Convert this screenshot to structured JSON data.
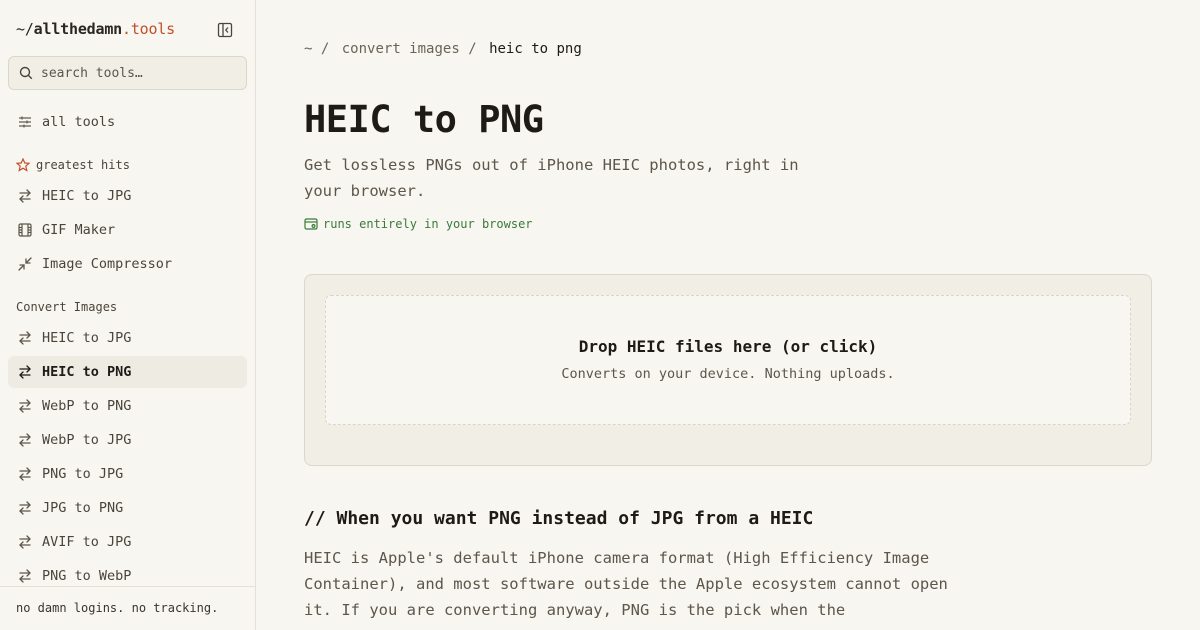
{
  "brand": {
    "tilde": "~/",
    "name": "allthedamn",
    "tld": ".tools"
  },
  "search": {
    "placeholder": "search tools…"
  },
  "nav": {
    "all_tools": "all tools",
    "greatest_hits_label": "greatest hits",
    "greatest_hits": [
      {
        "label": "HEIC to JPG",
        "icon": "arrows-swap-icon"
      },
      {
        "label": "GIF Maker",
        "icon": "film-icon"
      },
      {
        "label": "Image Compressor",
        "icon": "compress-icon"
      }
    ],
    "convert_images_label": "Convert Images",
    "convert_images": [
      {
        "label": "HEIC to JPG",
        "icon": "arrows-swap-icon",
        "active": false
      },
      {
        "label": "HEIC to PNG",
        "icon": "arrows-swap-icon",
        "active": true
      },
      {
        "label": "WebP to PNG",
        "icon": "arrows-swap-icon",
        "active": false
      },
      {
        "label": "WebP to JPG",
        "icon": "arrows-swap-icon",
        "active": false
      },
      {
        "label": "PNG to JPG",
        "icon": "arrows-swap-icon",
        "active": false
      },
      {
        "label": "JPG to PNG",
        "icon": "arrows-swap-icon",
        "active": false
      },
      {
        "label": "AVIF to JPG",
        "icon": "arrows-swap-icon",
        "active": false
      },
      {
        "label": "PNG to WebP",
        "icon": "arrows-swap-icon",
        "active": false
      }
    ]
  },
  "footer": {
    "text": "no damn logins. no tracking."
  },
  "breadcrumb": {
    "root": "~",
    "sep": "/",
    "section": "convert images",
    "current": "heic to png"
  },
  "page": {
    "title": "HEIC to PNG",
    "subtitle": "Get lossless PNGs out of iPhone HEIC photos, right in your browser.",
    "badge": "runs entirely in your browser"
  },
  "dropzone": {
    "title": "Drop HEIC files here (or click)",
    "subtitle": "Converts on your device. Nothing uploads."
  },
  "section": {
    "heading": "// When you want PNG instead of JPG from a HEIC",
    "body": "HEIC is Apple's default iPhone camera format (High Efficiency Image Container), and most software outside the Apple ecosystem cannot open it. If you are converting anyway, PNG is the pick when the"
  },
  "colors": {
    "accent": "#c0502a",
    "badge_green": "#3a7a3a",
    "background": "#f8f6f0",
    "active_bg": "#eeebe2"
  }
}
